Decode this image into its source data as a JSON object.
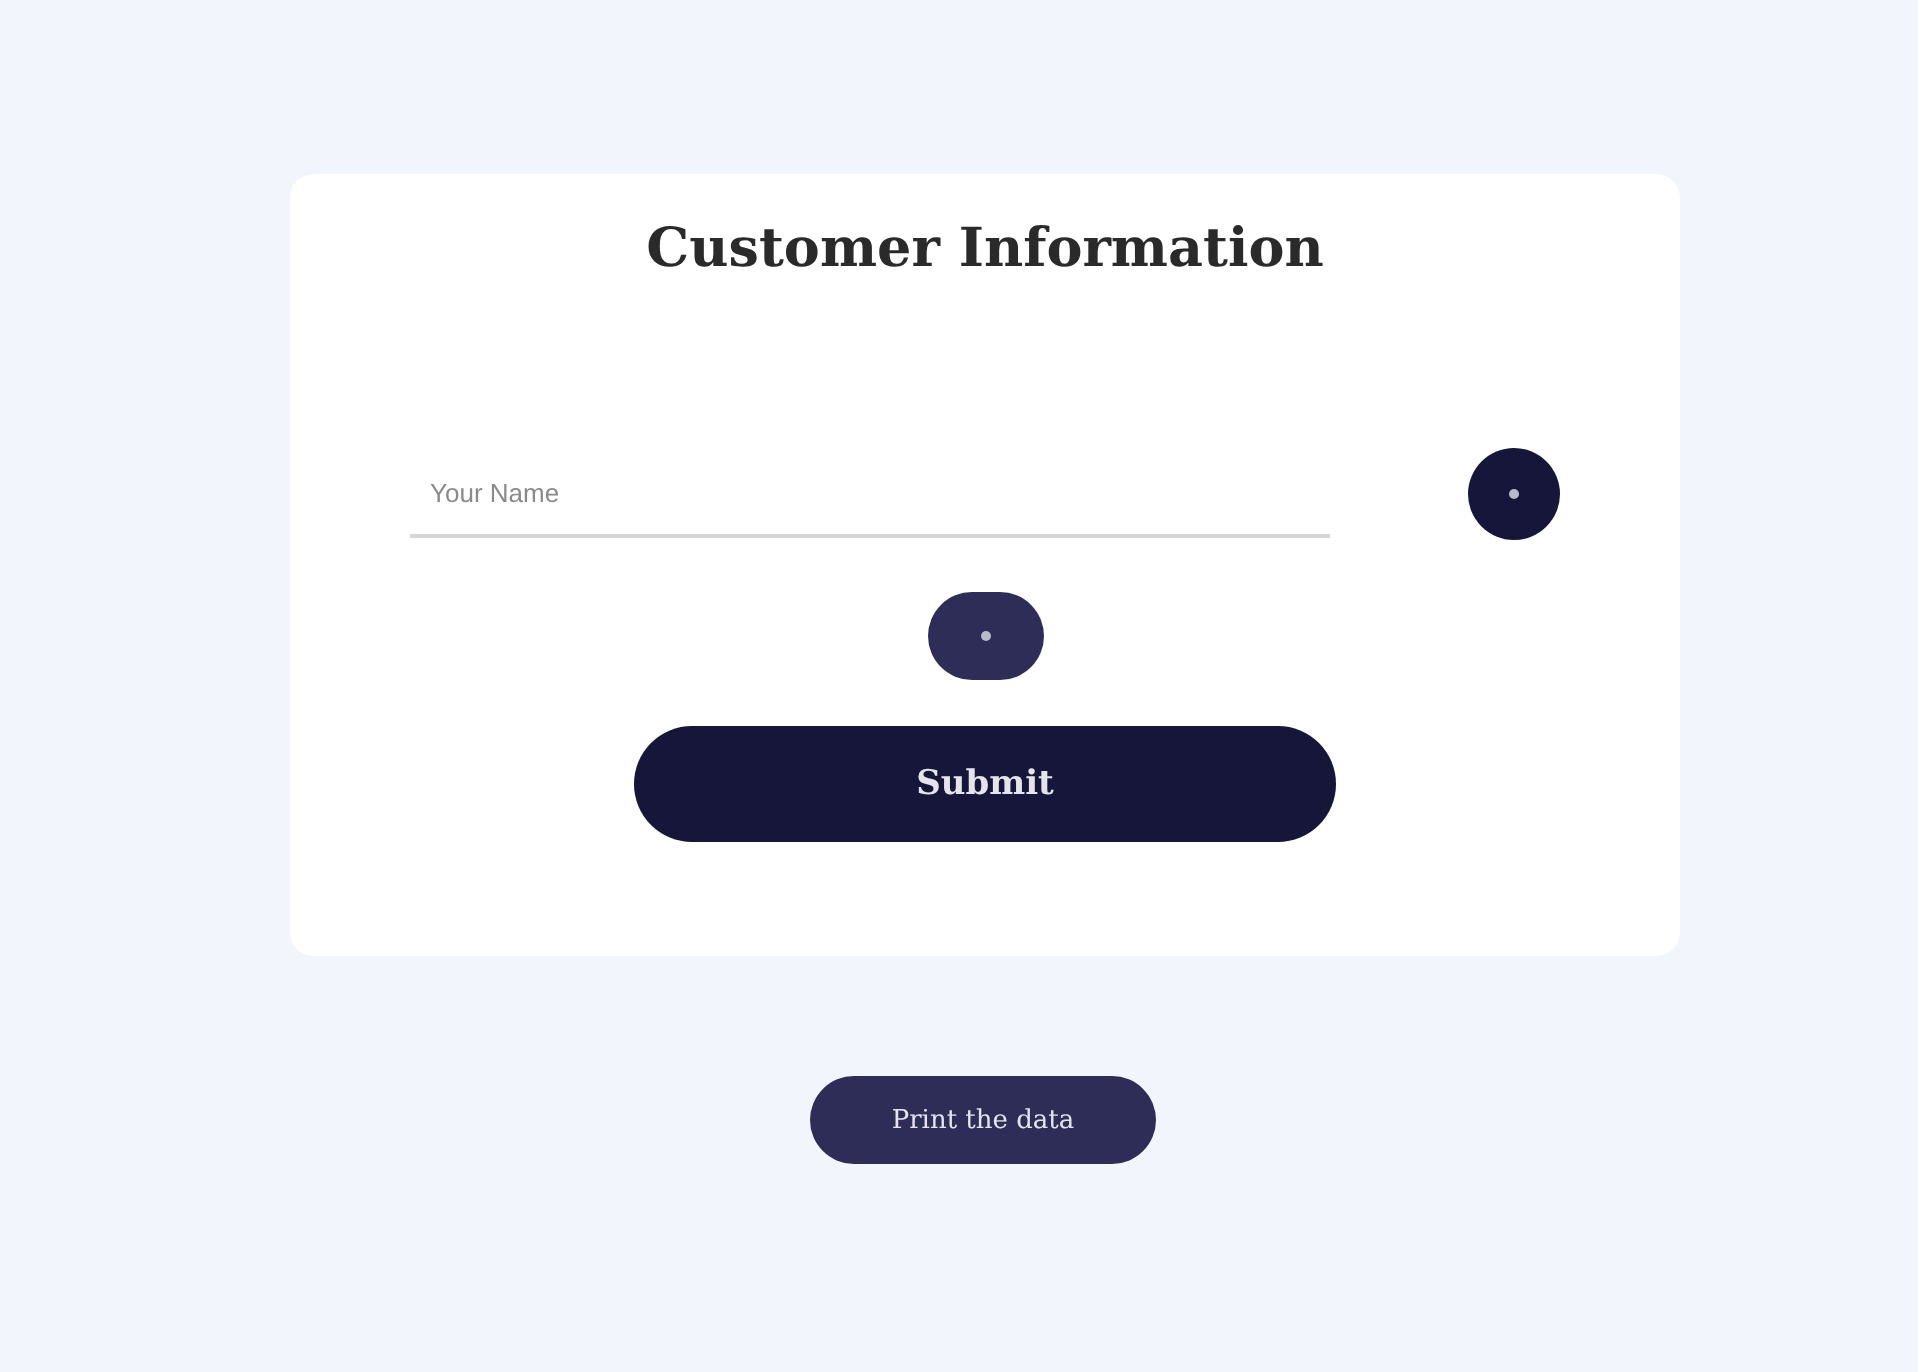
{
  "form": {
    "title": "Customer Information",
    "name_field": {
      "placeholder": "Your Name"
    },
    "submit": "Submit"
  },
  "print_button": "Print the data"
}
